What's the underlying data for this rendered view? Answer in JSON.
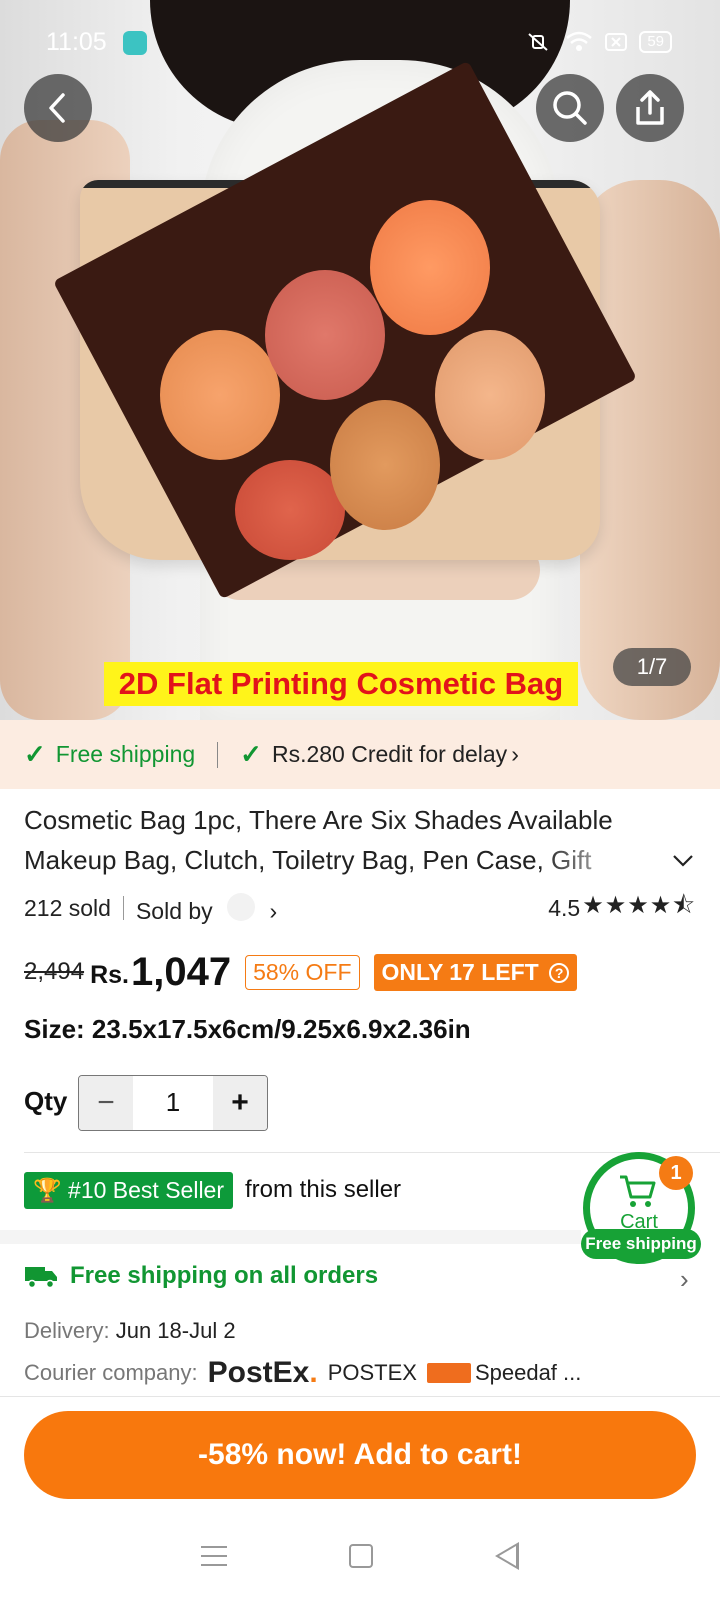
{
  "status_bar": {
    "time": "11:05",
    "battery": "59",
    "icons": [
      "app-notification-icon",
      "mute-vibrate-icon",
      "wifi-icon",
      "battery-saver-icon",
      "battery-icon"
    ]
  },
  "hero": {
    "caption": "2D Flat Printing Cosmetic Bag",
    "counter": "1/7",
    "buttons": [
      "back-icon",
      "search-icon",
      "share-icon"
    ]
  },
  "shipping_strip": {
    "free_shipping": "Free shipping",
    "credit": "Rs.280 Credit for delay"
  },
  "product": {
    "title": "Cosmetic Bag 1pc, There Are Six Shades Available Makeup Bag, Clutch, Toiletry Bag, Pen Case, Gift",
    "sold": "212 sold",
    "sold_by": "Sold by",
    "rating": "4.5",
    "stars": "★★★★⯪",
    "old_price": "2,494",
    "currency": "Rs.",
    "price": "1,047",
    "discount": "58% OFF",
    "stock": "ONLY 17 LEFT",
    "size_label": "Size:",
    "size_value": "23.5x17.5x6cm/9.25x6.9x2.36in"
  },
  "quantity": {
    "label": "Qty",
    "value": "1",
    "minus": "−",
    "plus": "+"
  },
  "bestseller": {
    "badge": "#10 Best Seller",
    "text": "from this seller"
  },
  "cart_float": {
    "label": "Cart",
    "count": "1",
    "free": "Free shipping"
  },
  "delivery": {
    "free_all": "Free shipping on all orders",
    "delivery_label": "Delivery:",
    "delivery_value": "Jun 18-Jul 2",
    "courier_label": "Courier company:",
    "courier_logo": "PostEx",
    "courier_1": "POSTEX",
    "courier_2": "Speedaf ..."
  },
  "cta": {
    "label": "-58% now! Add to cart!"
  },
  "colors": {
    "accent_orange": "#f8780d",
    "green": "#119632",
    "strip_bg": "#fcece1",
    "caption_bg": "#fff41a",
    "caption_text": "#e2131b"
  }
}
